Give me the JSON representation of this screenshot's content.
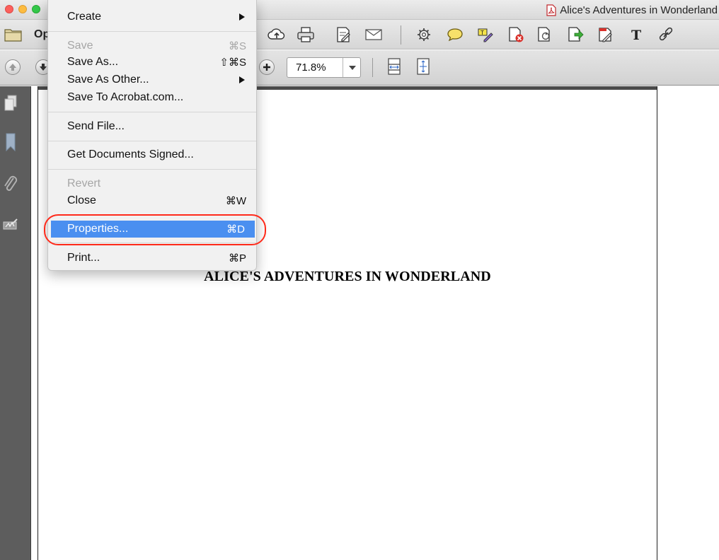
{
  "window": {
    "title": "Alice's Adventures in Wonderland"
  },
  "toolbar": {
    "open_label": "Op",
    "icons": [
      "folder-icon",
      "cloud-upload-icon",
      "print-icon",
      "edit-pdf-icon",
      "mail-icon",
      "gear-icon",
      "comment-icon",
      "highlight-icon",
      "delete-pages-icon",
      "export-icon",
      "share-icon",
      "sign-icon",
      "text-icon",
      "link-icon"
    ]
  },
  "navigation": {
    "zoom_value": "71.8%"
  },
  "menu": {
    "items": [
      {
        "label": "Create",
        "shortcut": "",
        "submenu": true,
        "disabled": false
      },
      {
        "label": "Save",
        "shortcut": "⌘S",
        "submenu": false,
        "disabled": true
      },
      {
        "label": "Save As...",
        "shortcut": "⇧⌘S",
        "submenu": false,
        "disabled": false
      },
      {
        "label": "Save As Other...",
        "shortcut": "",
        "submenu": true,
        "disabled": false
      },
      {
        "label": "Save To Acrobat.com...",
        "shortcut": "",
        "submenu": false,
        "disabled": false
      },
      {
        "label": "Send File...",
        "shortcut": "",
        "submenu": false,
        "disabled": false
      },
      {
        "label": "Get Documents Signed...",
        "shortcut": "",
        "submenu": false,
        "disabled": false
      },
      {
        "label": "Revert",
        "shortcut": "",
        "submenu": false,
        "disabled": true
      },
      {
        "label": "Close",
        "shortcut": "⌘W",
        "submenu": false,
        "disabled": false
      },
      {
        "label": "Properties...",
        "shortcut": "⌘D",
        "submenu": false,
        "disabled": false,
        "highlighted": true
      },
      {
        "label": "Print...",
        "shortcut": "⌘P",
        "submenu": false,
        "disabled": false
      }
    ]
  },
  "document": {
    "heading": "ALICE'S ADVENTURES IN WONDERLAND"
  },
  "colors": {
    "highlight": "#4a8ff0",
    "annotation_ring": "#ff2a1a",
    "sidepanel": "#5d5d5d"
  }
}
